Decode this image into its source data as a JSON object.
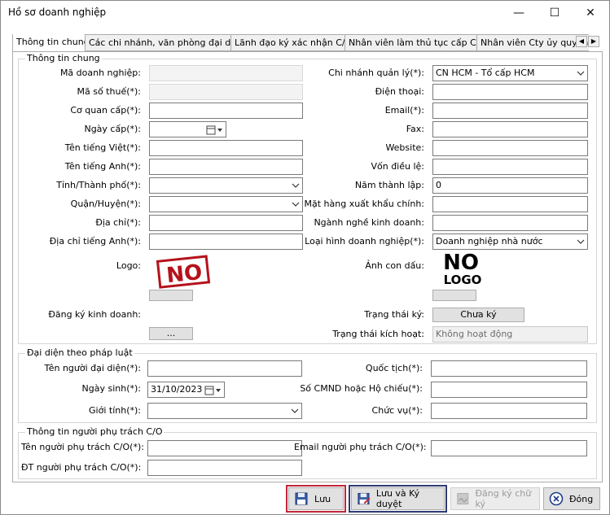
{
  "window": {
    "title": "Hồ sơ doanh nghiệp",
    "minimize": "—",
    "maximize": "☐",
    "close": "✕"
  },
  "tabs": [
    {
      "label": "Thông tin chung"
    },
    {
      "label": "Các chi nhánh, văn phòng đại diện"
    },
    {
      "label": "Lãnh đạo ký xác nhận C/O"
    },
    {
      "label": "Nhân viên làm thủ tục cấp C/O"
    },
    {
      "label": "Nhân viên Cty ủy quyền"
    }
  ],
  "general": {
    "group_label": "Thông tin chung",
    "ma_dn_label": "Mã doanh nghiệp:",
    "mst_label": "Mã số thuế(*):",
    "co_quan_cap_label": "Cơ quan cấp(*):",
    "ngay_cap_label": "Ngày cấp(*):",
    "ten_viet_label": "Tên tiếng Việt(*):",
    "ten_anh_label": "Tên tiếng Anh(*):",
    "tinh_label": "Tỉnh/Thành phố(*):",
    "quan_label": "Quận/Huyện(*):",
    "dia_chi_label": "Địa chỉ(*):",
    "dia_chi_anh_label": "Địa chỉ tiếng Anh(*):",
    "logo_label": "Logo:",
    "dkkd_label": "Đăng ký kinh doanh:",
    "dkkd_button": "...",
    "chi_nhanh_label": "Chi nhánh quản lý(*):",
    "chi_nhanh_value": "CN HCM - Tổ cấp HCM",
    "dien_thoai_label": "Điện thoại:",
    "email_label": "Email(*):",
    "fax_label": "Fax:",
    "website_label": "Website:",
    "von_label": "Vốn điều lệ:",
    "nam_label": "Năm thành lập:",
    "nam_value": "0",
    "mat_hang_label": "Mặt hàng xuất khẩu chính:",
    "nganh_label": "Ngành nghề kinh doanh:",
    "loai_hinh_label": "Loại hình doanh nghiệp(*):",
    "loai_hinh_value": "Doanh nghiệp nhà nước",
    "anh_con_dau_label": "Ảnh con dấu:",
    "trang_thai_ky_label": "Trạng thái ký:",
    "trang_thai_ky_button": "Chưa ký",
    "trang_thai_kh_label": "Trạng thái kích hoạt:",
    "trang_thai_kh_value": "Không hoạt động",
    "logo_placeholder": "NO",
    "stamp_line1": "NO",
    "stamp_line2": "LOGO"
  },
  "legal": {
    "group_label": "Đại diện theo pháp luật",
    "ten_label": "Tên người đại diện(*):",
    "ngay_sinh_label": "Ngày sinh(*):",
    "ngay_sinh_value": "31/10/2023",
    "gioi_tinh_label": "Giới tính(*):",
    "quoc_tich_label": "Quốc tịch(*):",
    "cmnd_label": "Số CMND hoặc Hộ chiếu(*):",
    "chuc_vu_label": "Chức vụ(*):"
  },
  "co": {
    "group_label": "Thông tin người phụ trách C/O",
    "ten_label": "Tên người phụ trách C/O(*):",
    "dt_label": "ĐT người phụ trách C/O(*):",
    "email_label": "Email người phụ trách C/O(*):"
  },
  "footer": {
    "luu": "Lưu",
    "luu_ky": "Lưu và Ký duyệt",
    "dang_ky_chu_ky": "Đăng ký chữ ký",
    "dong": "Đóng"
  },
  "colors": {
    "highlight_red": "#c0263a",
    "highlight_blue": "#2f3a74",
    "stamp_red": "#b5121b"
  }
}
